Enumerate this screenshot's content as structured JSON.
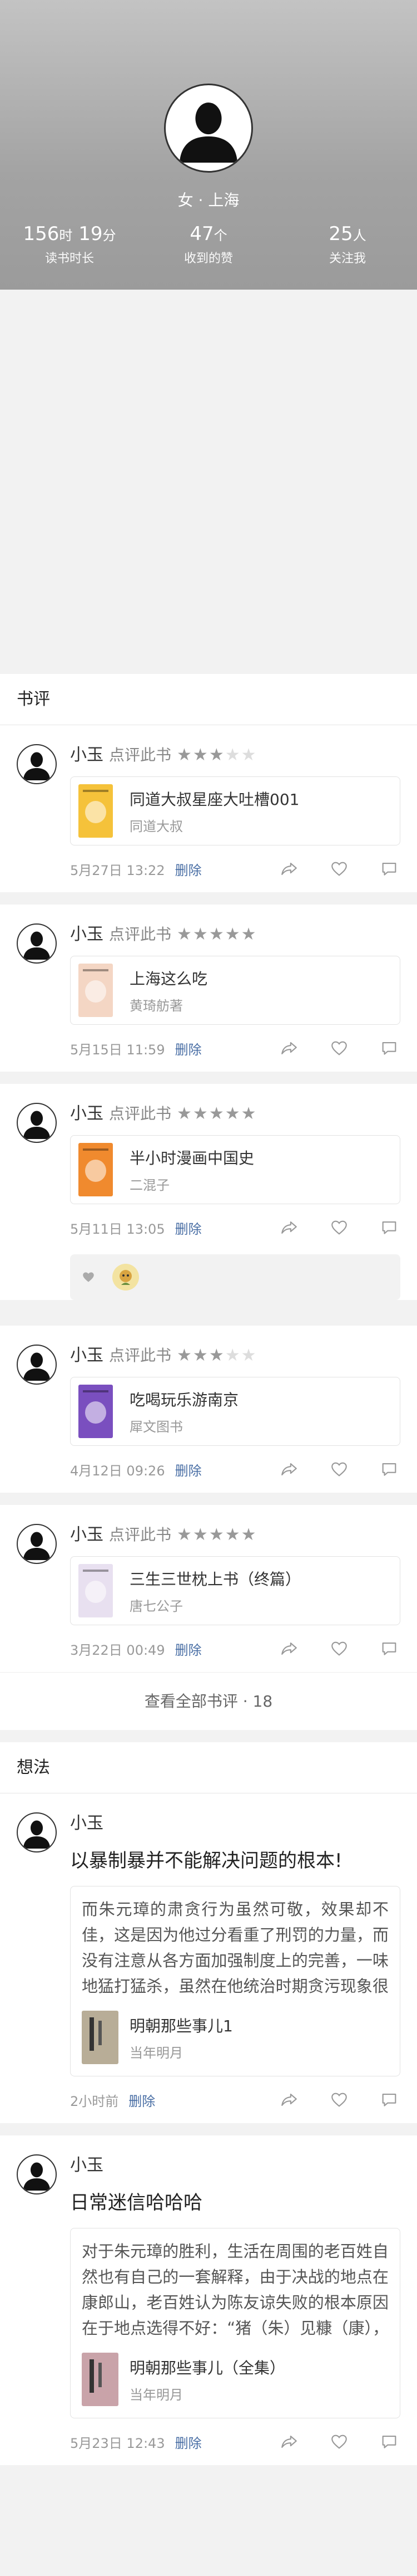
{
  "profile": {
    "gender_location": "女 · 上海",
    "stats": [
      {
        "num": "156",
        "num2": "19",
        "unit1": "时",
        "unit2": "分",
        "label": "读书时长"
      },
      {
        "num": "47",
        "unit1": "个",
        "label": "收到的赞"
      },
      {
        "num": "25",
        "unit1": "人",
        "label": "关注我"
      }
    ]
  },
  "reviews": {
    "title": "书评",
    "view_all": "查看全部书评 · 18",
    "items": [
      {
        "user": "小玉",
        "action": "点评此书",
        "rating": 3,
        "book_title": "同道大叔星座大吐槽001",
        "book_author": "同道大叔",
        "time": "5月27日 13:22",
        "delete": "删除",
        "cover_color": "#f5c23a"
      },
      {
        "user": "小玉",
        "action": "点评此书",
        "rating": 5,
        "book_title": "上海这么吃",
        "book_author": "黄琦舫著",
        "time": "5月15日 11:59",
        "delete": "删除",
        "cover_color": "#f4d6c4"
      },
      {
        "user": "小玉",
        "action": "点评此书",
        "rating": 5,
        "book_title": "半小时漫画中国史",
        "book_author": "二混子",
        "time": "5月11日 13:05",
        "delete": "删除",
        "cover_color": "#f08a2e"
      },
      {
        "user": "小玉",
        "action": "点评此书",
        "rating": 3,
        "book_title": "吃喝玩乐游南京",
        "book_author": "犀文图书",
        "time": "4月12日 09:26",
        "delete": "删除",
        "cover_color": "#7a4fbf"
      },
      {
        "user": "小玉",
        "action": "点评此书",
        "rating": 5,
        "book_title": "三生三世枕上书（终篇）",
        "book_author": "唐七公子",
        "time": "3月22日 00:49",
        "delete": "删除",
        "cover_color": "#e8e0f0"
      }
    ]
  },
  "thoughts": {
    "title": "想法",
    "items": [
      {
        "user": "小玉",
        "title": "以暴制暴并不能解决问题的根本!",
        "text": "而朱元璋的肃贪行为虽然可敬，效果却不佳，这是因为他过分看重了刑罚的力量，而没有注意从各方面加强制度上的完善，一味地猛打猛杀，虽然在他统治时期贪污现象很少，但他死后，明朝...",
        "book_title": "明朝那些事儿1",
        "book_author": "当年明月",
        "time": "2小时前",
        "delete": "删除"
      },
      {
        "user": "小玉",
        "title": "日常迷信哈哈哈",
        "text": "对于朱元璋的胜利，生活在周围的老百姓自然也有自己的一套解释，由于决战的地点在康郎山，老百姓认为陈友谅失败的根本原因在于地点选得不好：“猪（朱）见糠（康），喜洋洋。”所以...",
        "book_title": "明朝那些事儿（全集）",
        "book_author": "当年明月",
        "time": "5月23日 12:43",
        "delete": "删除"
      }
    ]
  },
  "colors": {
    "link": "#4a6fa5",
    "header_bg": "#a8a8a8"
  },
  "icons": [
    "user-silhouette-icon",
    "star-icon",
    "share-icon",
    "heart-icon",
    "comment-icon"
  ]
}
